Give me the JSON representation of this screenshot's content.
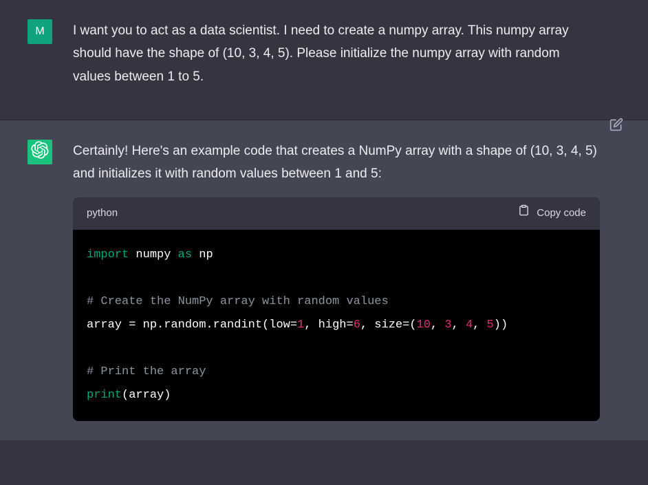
{
  "user": {
    "avatar_initial": "M",
    "text": "I want you to act as a data scientist. I need to create a numpy array. This numpy array should have the shape of (10, 3, 4, 5). Please initialize the numpy array with random values between 1 to 5."
  },
  "assistant": {
    "intro": "Certainly! Here's an example code that creates a NumPy array with a shape of (10, 3, 4, 5) and initializes it with random values between 1 and 5:",
    "code": {
      "language": "python",
      "copy_label": "Copy code",
      "tokens": {
        "import_kw": "import",
        "module": "numpy",
        "as_kw": "as",
        "alias": "np",
        "comment1": "# Create the NumPy array with random values",
        "line3_a": "array = np.random.randint(low=",
        "line3_b": "1",
        "line3_c": ", high=",
        "line3_d": "6",
        "line3_e": ", size=(",
        "line3_f": "10",
        "line3_g": ", ",
        "line3_h": "3",
        "line3_i": ", ",
        "line3_j": "4",
        "line3_k": ", ",
        "line3_l": "5",
        "line3_m": "))",
        "comment2": "# Print the array",
        "print_kw": "print",
        "print_arg": "(array)"
      }
    }
  }
}
